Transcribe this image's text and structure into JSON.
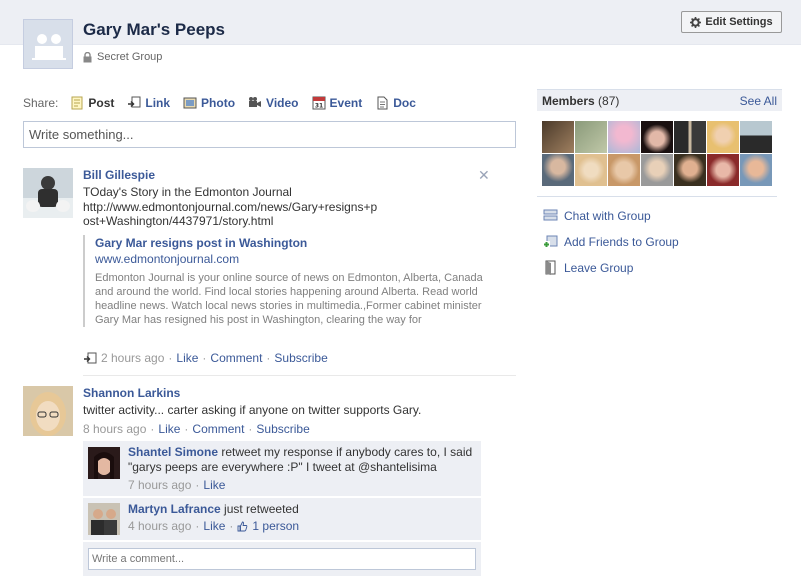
{
  "group": {
    "title": "Gary Mar's Peeps",
    "privacy": "Secret Group",
    "edit_settings": "Edit Settings"
  },
  "share": {
    "label": "Share:",
    "items": [
      {
        "label": "Post",
        "icon": "post-icon"
      },
      {
        "label": "Link",
        "icon": "link-icon"
      },
      {
        "label": "Photo",
        "icon": "photo-icon"
      },
      {
        "label": "Video",
        "icon": "video-icon"
      },
      {
        "label": "Event",
        "icon": "event-icon"
      },
      {
        "label": "Doc",
        "icon": "doc-icon"
      }
    ],
    "placeholder": "Write something..."
  },
  "stories": [
    {
      "actor": "Bill Gillespie",
      "message": "TOday's Story in the Edmonton Journal",
      "url_line1": "http://www.edmontonjournal.com/news/Gary+resigns+p",
      "url_line2": "ost+Washington/4437971/story.html",
      "attachment": {
        "title": "Gary Mar resigns post in Washington",
        "source": "www.edmontonjournal.com",
        "description": "Edmonton Journal is your online source of news on Edmonton, Alberta, Canada and around the world. Find local stories happening around Alberta. Read world headline news. Watch local news stories in multimedia.,Former cabinet minister Gary Mar has resigned his post in Washington, clearing the way for"
      },
      "time": "2 hours ago",
      "like": "Like",
      "comment": "Comment",
      "subscribe": "Subscribe"
    },
    {
      "actor": "Shannon Larkins",
      "message": "twitter activity... carter asking if anyone on twitter supports Gary.",
      "time": "8 hours ago",
      "like": "Like",
      "comment": "Comment",
      "subscribe": "Subscribe",
      "comments": [
        {
          "author": "Shantel Simone",
          "text": "retweet my response if anybody cares to, I said \"garys peeps are everywhere :P\" I tweet at @shantelisima",
          "time": "7 hours ago",
          "like": "Like"
        },
        {
          "author": "Martyn Lafrance",
          "text": "just retweeted",
          "time": "4 hours ago",
          "like": "Like",
          "likes_count": "1 person"
        }
      ],
      "comment_placeholder": "Write a comment..."
    }
  ],
  "sidebar": {
    "members_label": "Members",
    "members_count": "(87)",
    "see_all": "See All",
    "actions": [
      {
        "label": "Chat with Group",
        "icon": "chat-icon"
      },
      {
        "label": "Add Friends to Group",
        "icon": "add-friends-icon"
      },
      {
        "label": "Leave Group",
        "icon": "leave-door-icon"
      }
    ]
  },
  "colors": {
    "link": "#3b5998",
    "header_band": "#edeff4",
    "comment_bg": "#edeff4"
  }
}
